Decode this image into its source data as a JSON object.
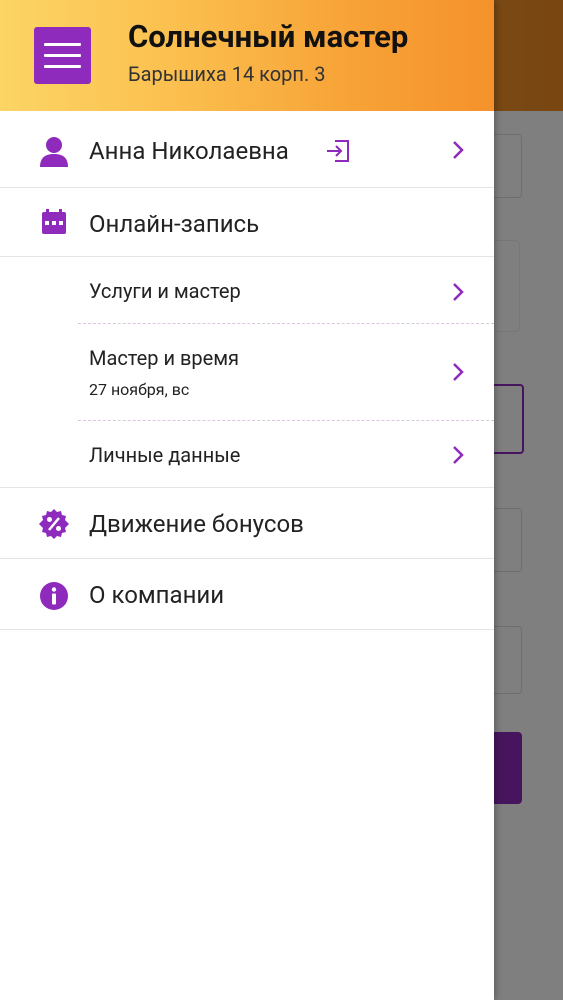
{
  "header": {
    "title": "Солнечный мастер",
    "subtitle": "Барышиха 14 корп. 3"
  },
  "user": {
    "name": "Анна Николаевна"
  },
  "menu": {
    "online_booking": "Онлайн-запись",
    "services": "Услуги и мастер",
    "master_time": "Мастер и время",
    "master_time_date": "27 ноября, вс",
    "personal_data": "Личные данные",
    "bonus_history": "Движение бонусов",
    "about": "О компании"
  },
  "colors": {
    "accent": "#8e2bbd",
    "header_start": "#fbd565",
    "header_end": "#f5922b"
  }
}
